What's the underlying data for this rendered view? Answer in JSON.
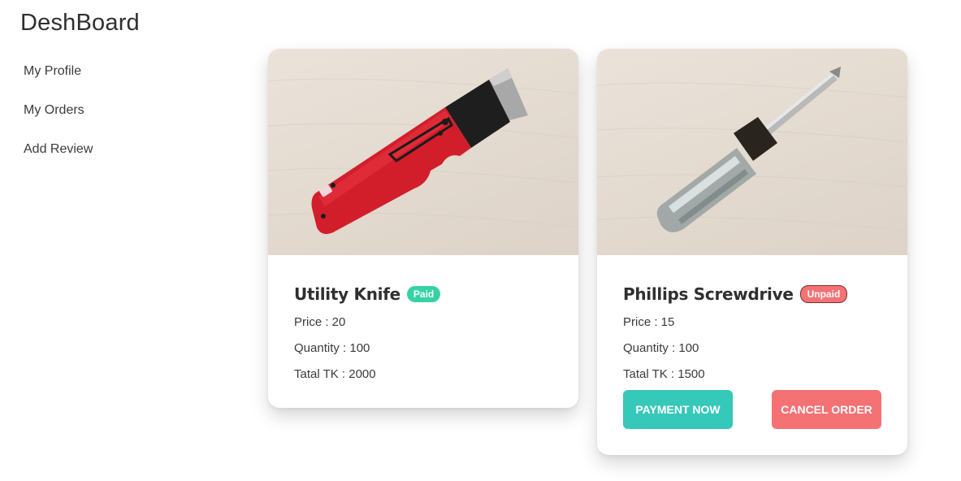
{
  "header": {
    "title": "DeshBoard"
  },
  "sidebar": {
    "items": [
      {
        "label": "My Profile"
      },
      {
        "label": "My Orders"
      },
      {
        "label": "Add Review"
      }
    ]
  },
  "orders": [
    {
      "image_icon": "utility-knife-image",
      "name": "Utility Knife",
      "status": "Paid",
      "price": "Price : 20",
      "quantity": "Quantity : 100",
      "total": "Tatal TK : 2000"
    },
    {
      "image_icon": "screwdriver-image",
      "name": "Phillips Screwdrive",
      "status": "Unpaid",
      "price": "Price : 15",
      "quantity": "Quantity : 100",
      "total": "Tatal TK : 1500",
      "payment_label": "PAYMENT NOW",
      "cancel_label": "CANCEL ORDER"
    }
  ],
  "colors": {
    "paid_badge": "#36d2a6",
    "unpaid_badge": "#f47174",
    "payment_button": "#36c8b8",
    "cancel_button": "#f47174"
  }
}
